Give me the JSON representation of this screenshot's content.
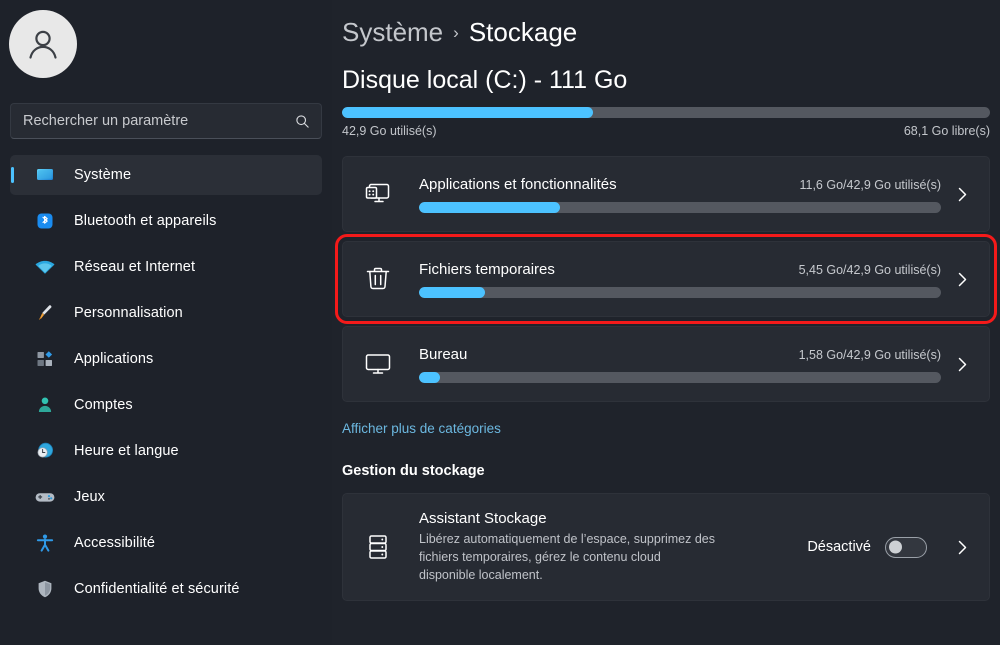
{
  "sidebar": {
    "avatar": {
      "icon": "user-avatar-icon"
    },
    "search": {
      "placeholder": "Rechercher un paramètre",
      "value": "",
      "icon": "search-icon"
    },
    "items": [
      {
        "label": "Système",
        "icon": "monitor-icon",
        "selected": true
      },
      {
        "label": "Bluetooth et appareils",
        "icon": "bluetooth-icon",
        "selected": false
      },
      {
        "label": "Réseau et Internet",
        "icon": "wifi-icon",
        "selected": false
      },
      {
        "label": "Personnalisation",
        "icon": "paintbrush-icon",
        "selected": false
      },
      {
        "label": "Applications",
        "icon": "apps-icon",
        "selected": false
      },
      {
        "label": "Comptes",
        "icon": "person-icon",
        "selected": false
      },
      {
        "label": "Heure et langue",
        "icon": "clock-globe-icon",
        "selected": false
      },
      {
        "label": "Jeux",
        "icon": "gamepad-icon",
        "selected": false
      },
      {
        "label": "Accessibilité",
        "icon": "accessibility-icon",
        "selected": false
      },
      {
        "label": "Confidentialité et sécurité",
        "icon": "shield-icon",
        "selected": false
      }
    ]
  },
  "main": {
    "breadcrumb": {
      "parent": "Système",
      "separator": "›",
      "current": "Stockage"
    },
    "drive": {
      "title": "Disque local (C:) - 111 Go",
      "used_label": "42,9 Go utilisé(s)",
      "free_label": "68,1 Go libre(s)",
      "fill_percent": 38.7
    },
    "categories": [
      {
        "title": "Applications et fonctionnalités",
        "value": "11,6 Go/42,9 Go utilisé(s)",
        "icon": "apps-monitor-icon",
        "fill_percent": 27,
        "highlighted": false
      },
      {
        "title": "Fichiers temporaires",
        "value": "5,45 Go/42,9 Go utilisé(s)",
        "icon": "trash-icon",
        "fill_percent": 12.7,
        "highlighted": true
      },
      {
        "title": "Bureau",
        "value": "1,58 Go/42,9 Go utilisé(s)",
        "icon": "desktop-monitor-icon",
        "fill_percent": 4,
        "highlighted": false
      }
    ],
    "more_categories_link": "Afficher plus de catégories",
    "management": {
      "heading": "Gestion du stockage",
      "storage_sense": {
        "title": "Assistant Stockage",
        "description": "Libérez automatiquement de l’espace, supprimez des fichiers temporaires, gérez le contenu cloud disponible localement.",
        "icon": "drive-stack-icon",
        "toggle_label": "Désactivé",
        "toggle_on": false
      }
    }
  },
  "colors": {
    "accent": "#4cc2ff",
    "highlight": "#f41a1a",
    "link": "#6cb8e0",
    "track": "#545860",
    "card_bg": "#272b33",
    "page_bg": "#1f232b"
  }
}
